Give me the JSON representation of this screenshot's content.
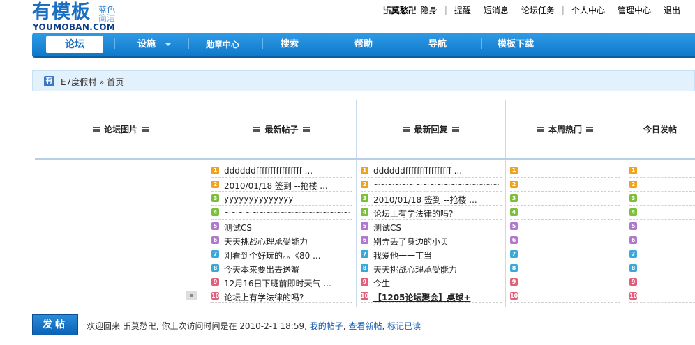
{
  "logo": {
    "main": "有模板",
    "side1": "蓝色",
    "side2": "简洁",
    "sub": "YOUMOBAN.COM"
  },
  "topnav": {
    "user": "卐莫愁卍",
    "invisible": "隐身",
    "links": [
      "提醒",
      "短消息",
      "论坛任务",
      "个人中心",
      "管理中心",
      "退出"
    ]
  },
  "mainnav": {
    "items": [
      "论坛",
      "设施",
      "勋章中心",
      "搜索",
      "帮助",
      "导航",
      "模板下载"
    ]
  },
  "breadcrumb": {
    "forum": "E7度假村",
    "sep": "»",
    "current": "首页"
  },
  "columns": {
    "pics": "论坛图片",
    "latest_posts": "最新帖子",
    "latest_replies": "最新回复",
    "weekly_hot": "本周热门",
    "today_posts": "今日发帖"
  },
  "latest_posts": [
    "ddddddffffffffffffffff ...",
    "2010/01/18 签到 --抢楼 ...",
    "yyyyyyyyyyyyyy",
    "~~~~~~~~~~~~~~~~~~~~",
    "测试CS",
    "天天挑战心理承受能力",
    "刚看到个好玩的。。《80 ...",
    "今天本来要出去送蟹",
    "12月16日下班前即时天气 ...",
    "论坛上有学法律的吗?"
  ],
  "latest_replies": [
    "ddddddffffffffffffffff ...",
    "~~~~~~~~~~~~~~~~~~~~",
    "2010/01/18 签到 --抢楼 ...",
    "论坛上有学法律的吗?",
    "测试CS",
    "别弄丢了身边的小贝",
    "我爱他一一丁当",
    "天天挑战心理承受能力",
    "今生",
    "【1205论坛聚会】桌球+"
  ],
  "rank_numbers": [
    "1",
    "2",
    "3",
    "4",
    "5",
    "6",
    "7",
    "8",
    "9",
    "10"
  ],
  "rank_colors": [
    "#f0a21c",
    "#f0a21c",
    "#7cbf3a",
    "#7cbf3a",
    "#b07acc",
    "#b07acc",
    "#3aa8d8",
    "#3aa8d8",
    "#e0607a",
    "#e0607a"
  ],
  "post_button": "发帖",
  "welcome": {
    "text": "欢迎回来 卐莫愁卍, 你上次访问时间是在 2010-2-1 18:59,",
    "my_posts": "我的帖子",
    "new_posts": "查看新帖",
    "mark_read": "标记已读"
  }
}
